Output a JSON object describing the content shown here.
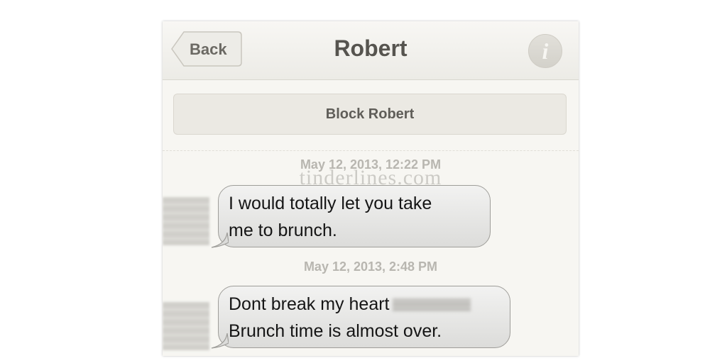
{
  "navbar": {
    "back_label": "Back",
    "title": "Robert",
    "info_label": "i"
  },
  "block_button": {
    "label": "Block Robert"
  },
  "watermark": "tinderlines.com",
  "messages": [
    {
      "timestamp": "May 12, 2013, 12:22 PM",
      "lines": [
        "I would totally let you take",
        "me to brunch."
      ]
    },
    {
      "timestamp": "May 12, 2013, 2:48 PM",
      "lines": [
        "Dont break my heart",
        "Brunch time is almost over."
      ]
    }
  ],
  "colors": {
    "background": "#f7f6f2",
    "bubble": "#e6e6e4",
    "text": "#151515",
    "timestamp": "#b8b6b0"
  }
}
